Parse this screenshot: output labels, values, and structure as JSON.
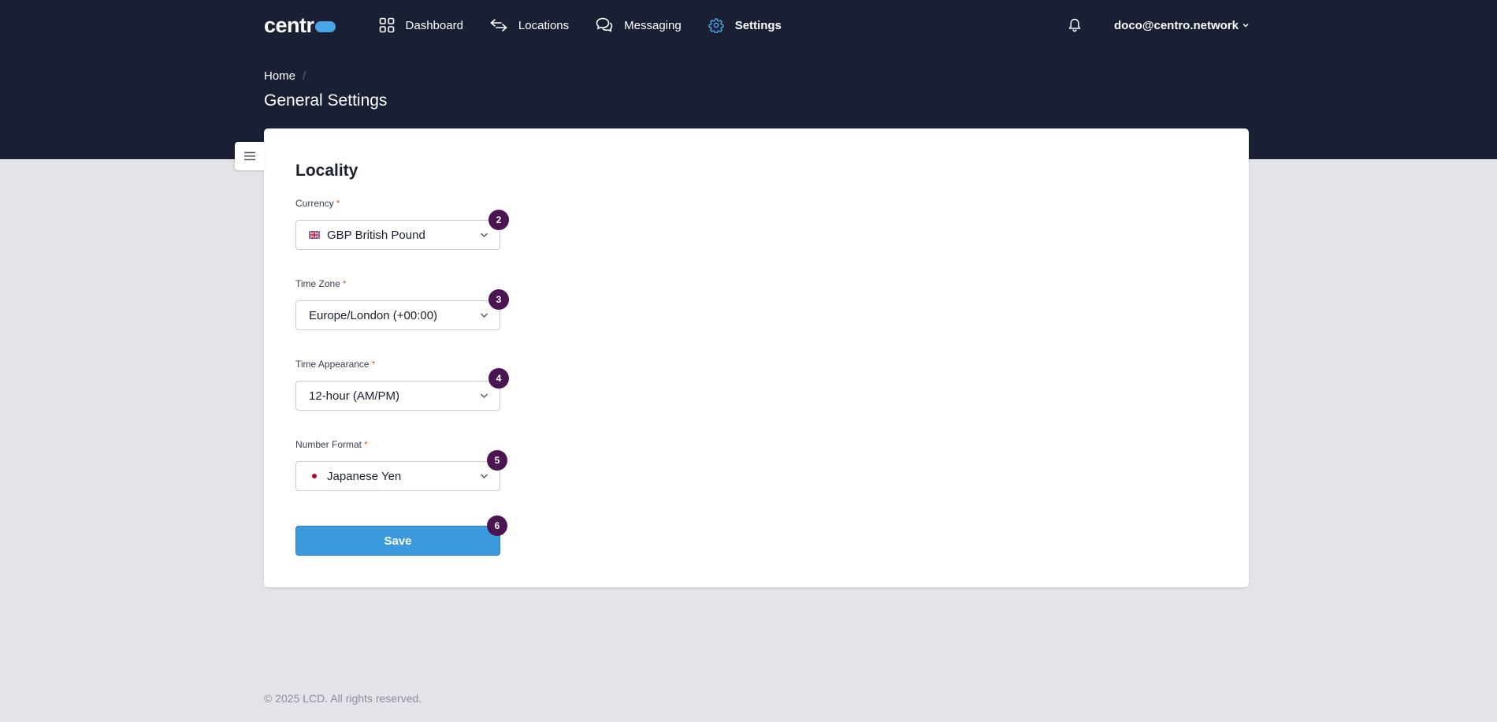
{
  "app": {
    "logo_text": "centr",
    "brand_color": "#47a6e6",
    "header_bg": "#1b1f34"
  },
  "nav": {
    "items": [
      {
        "label": "Dashboard",
        "icon": "grid-icon"
      },
      {
        "label": "Locations",
        "icon": "arrows-exchange-icon"
      },
      {
        "label": "Messaging",
        "icon": "chat-bubbles-icon"
      },
      {
        "label": "Settings",
        "icon": "gear-icon",
        "active": true
      }
    ],
    "active_color": "#47a6e6",
    "user_email": "doco@centro.network",
    "user_menu_icon": "chevron-down-icon",
    "notifications_icon": "bell-icon"
  },
  "breadcrumb": {
    "home": "Home",
    "separator": "/"
  },
  "page": {
    "title": "General Settings"
  },
  "sidebar_toggle_icon": "hamburger-icon",
  "form": {
    "section_title": "Locality",
    "required_mark": "*",
    "fields": [
      {
        "label": "Currency",
        "value": "GBP British Pound",
        "icon": "uk-flag-icon",
        "badge": "2"
      },
      {
        "label": "Time Zone",
        "value": "Europe/London (+00:00)",
        "badge": "3"
      },
      {
        "label": "Time Appearance",
        "value": "12-hour (AM/PM)",
        "badge": "4"
      },
      {
        "label": "Number Format",
        "value": "Japanese Yen",
        "icon": "japan-flag-icon",
        "badge": "5"
      }
    ],
    "save_label": "Save",
    "save_badge": "6",
    "save_color": "#3b99dd",
    "badge_color": "#4a1550"
  },
  "footer": {
    "text": "© 2025 LCD. All rights reserved."
  }
}
